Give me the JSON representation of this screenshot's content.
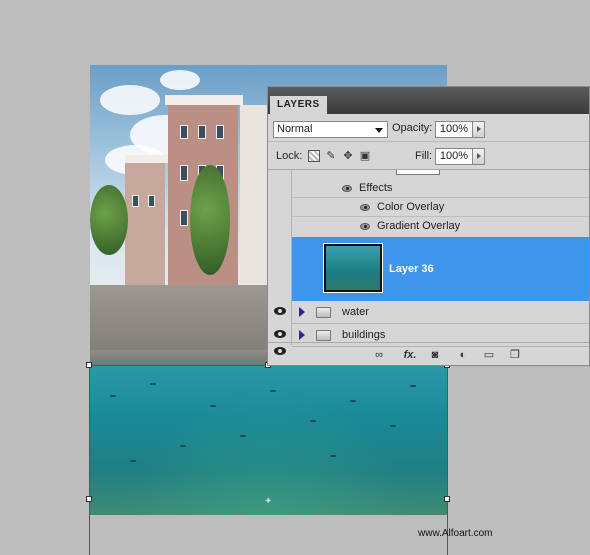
{
  "layers_panel": {
    "tab_label": "LAYERS",
    "blend_mode": "Normal",
    "opacity_label": "Opacity:",
    "opacity_value": "100%",
    "lock_label": "Lock:",
    "fill_label": "Fill:",
    "fill_value": "100%",
    "effects": {
      "header": "Effects",
      "items": [
        "Color Overlay",
        "Gradient Overlay"
      ]
    },
    "selected_layer": "Layer 36",
    "groups": [
      "water",
      "buildings"
    ],
    "bottom_icons": [
      "link-icon",
      "fx-icon",
      "mask-icon",
      "adjustment-icon",
      "folder-icon",
      "new-layer-icon"
    ],
    "fx_text": "fx.",
    "selection_color": "#3e95ea"
  },
  "watermark": "www.Alfoart.com"
}
